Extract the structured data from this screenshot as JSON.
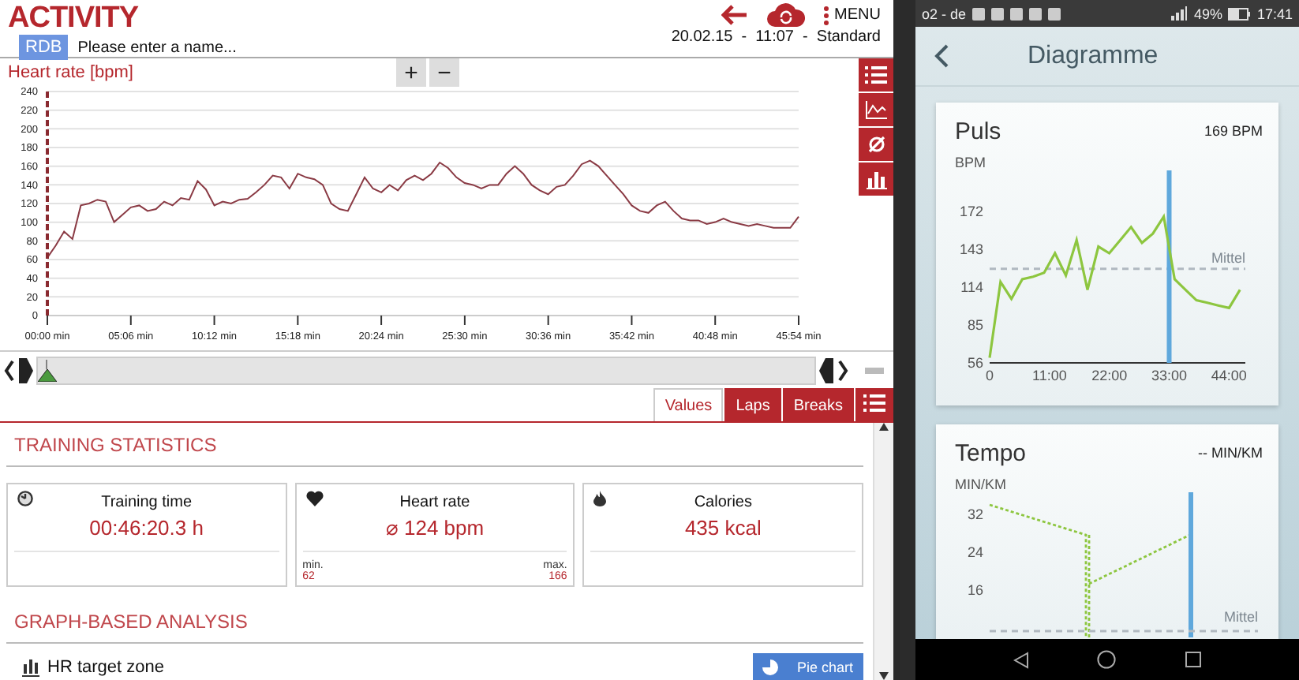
{
  "header": {
    "title": "ACTIVITY",
    "badge": "RDB",
    "name_placeholder": "Please enter a name...",
    "menu_label": "MENU",
    "date_line": "20.02.15  -  11:07  -  Standard"
  },
  "chart": {
    "title": "Heart rate [bpm]",
    "zoom_buttons": [
      "+",
      "−"
    ],
    "chart_data": {
      "type": "line",
      "grid": true,
      "ylim": [
        0,
        240
      ],
      "yticks": [
        0,
        20,
        40,
        60,
        80,
        100,
        120,
        140,
        160,
        180,
        200,
        220,
        240
      ],
      "categories": [
        "00:00 min",
        null,
        null,
        null,
        null,
        null,
        null,
        null,
        null,
        null,
        "05:06 min",
        null,
        null,
        null,
        null,
        null,
        null,
        null,
        null,
        null,
        "10:12 min",
        null,
        null,
        null,
        null,
        null,
        null,
        null,
        null,
        null,
        "15:18 min",
        null,
        null,
        null,
        null,
        null,
        null,
        null,
        null,
        null,
        "20:24 min",
        null,
        null,
        null,
        null,
        null,
        null,
        null,
        null,
        null,
        "25:30 min",
        null,
        null,
        null,
        null,
        null,
        null,
        null,
        null,
        null,
        "30:36 min",
        null,
        null,
        null,
        null,
        null,
        null,
        null,
        null,
        null,
        "35:42 min",
        null,
        null,
        null,
        null,
        null,
        null,
        null,
        null,
        null,
        "40:48 min",
        null,
        null,
        null,
        null,
        null,
        null,
        null,
        null,
        null,
        "45:54 min"
      ],
      "series": [
        {
          "color": "#8a3a44",
          "values": [
            62,
            75,
            90,
            82,
            118,
            120,
            124,
            122,
            100,
            108,
            116,
            118,
            112,
            114,
            122,
            118,
            126,
            124,
            144,
            135,
            118,
            122,
            120,
            124,
            125,
            132,
            140,
            150,
            148,
            136,
            152,
            148,
            146,
            140,
            120,
            114,
            112,
            130,
            148,
            136,
            132,
            140,
            134,
            145,
            150,
            145,
            152,
            164,
            158,
            148,
            142,
            140,
            136,
            140,
            140,
            152,
            160,
            152,
            140,
            134,
            130,
            138,
            140,
            150,
            162,
            166,
            160,
            150,
            140,
            130,
            118,
            112,
            110,
            118,
            122,
            112,
            104,
            102,
            102,
            98,
            100,
            104,
            100,
            98,
            96,
            98,
            96,
            94,
            94,
            94,
            106
          ]
        }
      ]
    }
  },
  "scrubber": {
    "level": 0
  },
  "tabs": [
    {
      "label": "Values",
      "selected": true
    },
    {
      "label": "Laps",
      "selected": false
    },
    {
      "label": "Breaks",
      "selected": false
    }
  ],
  "stats": {
    "heading": "TRAINING STATISTICS",
    "cards": [
      {
        "kind": "time",
        "label": "Training time",
        "value": "00:46:20.3 h"
      },
      {
        "kind": "heart",
        "label": "Heart rate",
        "value": "⌀ 124 bpm",
        "min_label": "min.",
        "min": "62",
        "max_label": "max.",
        "max": "166"
      },
      {
        "kind": "flame",
        "label": "Calories",
        "value": "435 kcal"
      }
    ]
  },
  "analysis": {
    "heading": "GRAPH-BASED ANALYSIS",
    "item": "HR target zone",
    "button": "Pie chart"
  },
  "phone": {
    "status": {
      "carrier": "o2 - de",
      "battery": "49%",
      "clock": "17:41"
    },
    "title": "Diagramme",
    "cards": [
      {
        "title": "Puls",
        "reading": "169 BPM",
        "unit": "BPM",
        "chart_data": {
          "type": "line",
          "x": [
            0,
            2,
            4,
            6,
            8,
            10,
            12,
            14,
            16,
            18,
            20,
            22,
            24,
            26,
            28,
            30,
            32,
            34,
            36,
            38,
            40,
            42,
            44,
            46
          ],
          "xlim": [
            0,
            47
          ],
          "ylim": [
            56,
            172
          ],
          "yticks": [
            56,
            85,
            114,
            143,
            172
          ],
          "xticks": [
            {
              "value": 0,
              "label": "0"
            },
            {
              "value": 11,
              "label": "11:00"
            },
            {
              "value": 22,
              "label": "22:00"
            },
            {
              "value": 33,
              "label": "33:00"
            },
            {
              "value": 44,
              "label": "44:00"
            }
          ],
          "series": [
            {
              "color": "#8dc63f",
              "values": [
                60,
                118,
                105,
                120,
                122,
                125,
                140,
                123,
                150,
                112,
                145,
                140,
                150,
                160,
                148,
                155,
                168,
                120,
                112,
                104,
                102,
                100,
                98,
                112
              ]
            }
          ],
          "ref_lines": [
            {
              "axis": "y",
              "value": 128,
              "label": "Mittel"
            },
            {
              "axis": "x",
              "value": 33
            }
          ]
        }
      },
      {
        "title": "Tempo",
        "reading": "-- MIN/KM",
        "unit": "MIN/KM",
        "y_labels": [
          "32",
          "24",
          "16"
        ],
        "average_label": "Mittel"
      }
    ]
  }
}
